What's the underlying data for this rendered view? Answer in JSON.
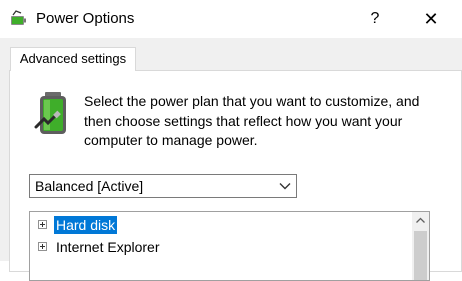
{
  "window": {
    "title": "Power Options",
    "help_glyph": "?",
    "close_glyph": "✕",
    "icon": "power-options-icon"
  },
  "tab": {
    "label": "Advanced settings"
  },
  "description": "Select the power plan that you want to customize, and then choose settings that reflect how you want your computer to manage power.",
  "plan_select": {
    "value": "Balanced [Active]",
    "icon": "chevron-down-icon"
  },
  "tree": {
    "items": [
      {
        "label": "Hard disk",
        "selected": true,
        "icon": "expand-plus-icon"
      },
      {
        "label": "Internet Explorer",
        "selected": false,
        "icon": "expand-plus-icon"
      }
    ]
  },
  "colors": {
    "selection": "#0078d7",
    "battery_green": "#3fae2a",
    "dialog_bg": "#f0f0f0"
  }
}
